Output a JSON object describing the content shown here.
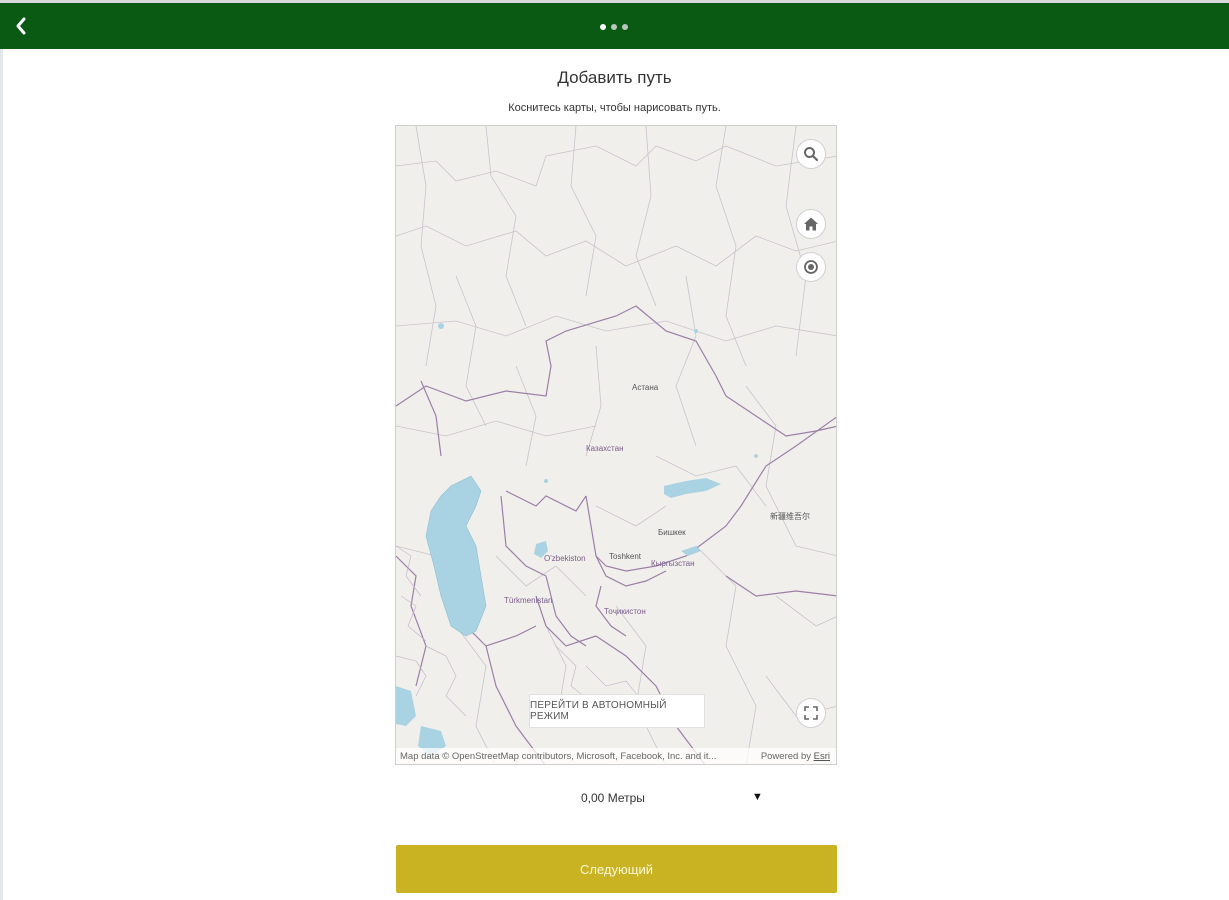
{
  "header": {
    "back_icon": "chevron-left-icon",
    "step_dots": [
      true,
      false,
      false
    ]
  },
  "page": {
    "title": "Добавить путь",
    "subtitle": "Коснитесь карты, чтобы нарисовать путь."
  },
  "map": {
    "labels": {
      "astana": "Астана",
      "kazakhstan": "Казахстан",
      "uzbekistan": "O'zbekiston",
      "turkmenistan": "Türkmenistan",
      "tashkent": "Toshkent",
      "kyrgyzstan": "Кыргызстан",
      "tajikistan": "Тоҷикистон",
      "bishkek": "Бишкек",
      "xinjiang": "新疆维吾尔"
    },
    "offline_button": "ПЕРЕЙТИ В АВТОНОМНЫЙ РЕЖИМ",
    "attribution": "Map data © OpenStreetMap contributors, Microsoft, Facebook, Inc. and it...",
    "powered_by": "Powered by ",
    "esri": "Esri",
    "controls": [
      "search-icon",
      "home-icon",
      "locate-icon",
      "fullscreen-icon"
    ]
  },
  "distance": {
    "value": "0,00 Метры",
    "arrow": "▼"
  },
  "footer": {
    "next_label": "Следующий"
  },
  "colors": {
    "header_bg": "#0b5a14",
    "next_button_bg": "#c9b323",
    "water": "#a9d3e3",
    "border_purple": "#9b7fa8"
  }
}
